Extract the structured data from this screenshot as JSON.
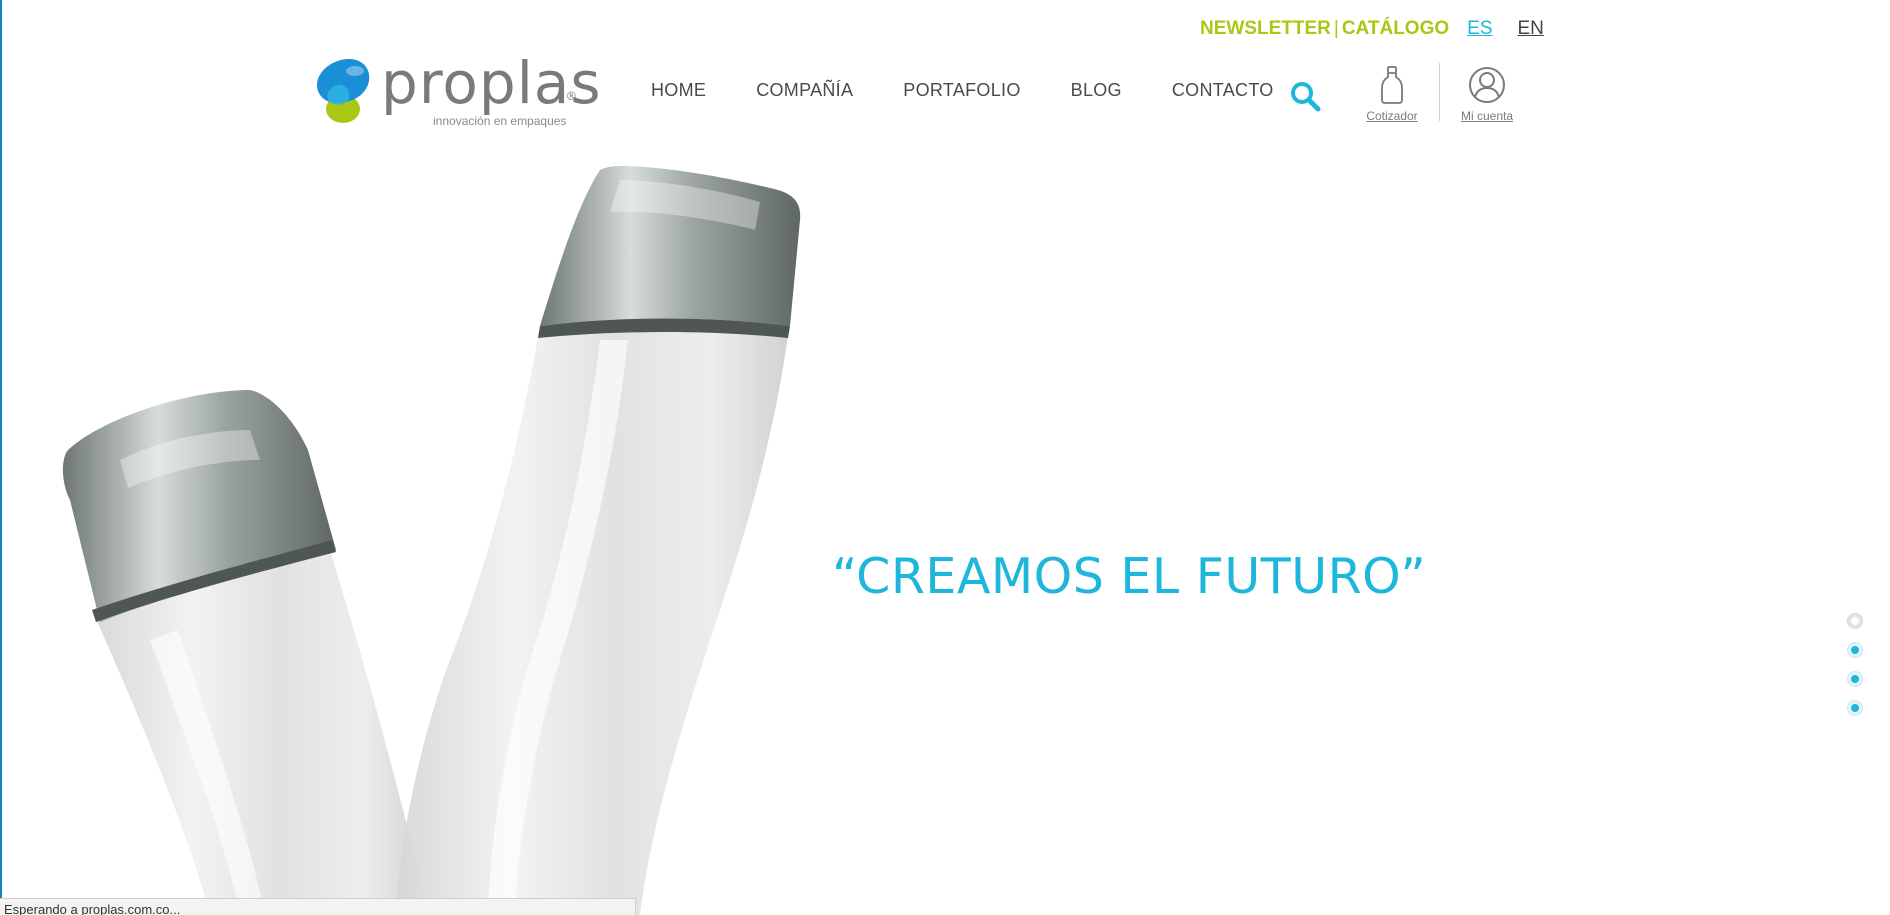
{
  "topbar": {
    "newsletter": "NEWSLETTER",
    "separator": "|",
    "catalog": "CATÁLOGO",
    "lang_es": "ES",
    "lang_en": "EN"
  },
  "logo": {
    "name": "proplas",
    "registered": "®",
    "tagline": "innovación en empaques"
  },
  "nav": {
    "items": [
      "HOME",
      "COMPAÑÍA",
      "PORTAFOLIO",
      "BLOG",
      "CONTACTO"
    ]
  },
  "tools": {
    "search_icon": "search-icon",
    "cotizador_label": "Cotizador",
    "cuenta_label": "Mi cuenta"
  },
  "hero": {
    "headline": "“CREAMOS EL FUTURO”",
    "slides": {
      "count": 4,
      "active": 1
    }
  },
  "status_bar": {
    "text": "Esperando a proplas.com.co..."
  },
  "colors": {
    "accent_blue": "#1fb6dc",
    "accent_green": "#a8c813",
    "nav_text": "#4a4a4a"
  }
}
